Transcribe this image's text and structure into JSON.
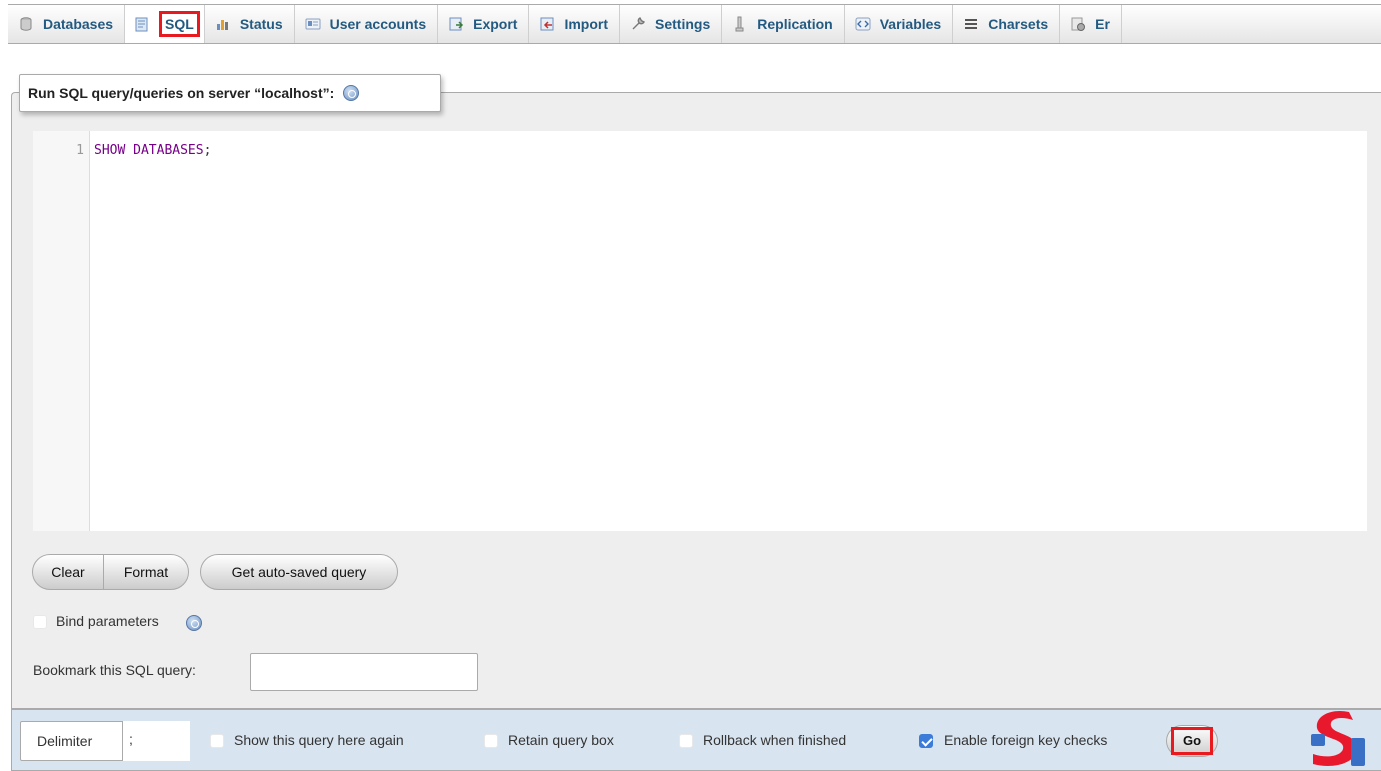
{
  "tabs": [
    {
      "label": "Databases",
      "icon": "database-icon"
    },
    {
      "label": "SQL",
      "icon": "sql-icon",
      "active": true
    },
    {
      "label": "Status",
      "icon": "status-icon"
    },
    {
      "label": "User accounts",
      "icon": "user-accounts-icon"
    },
    {
      "label": "Export",
      "icon": "export-icon"
    },
    {
      "label": "Import",
      "icon": "import-icon"
    },
    {
      "label": "Settings",
      "icon": "wrench-icon"
    },
    {
      "label": "Replication",
      "icon": "replication-icon"
    },
    {
      "label": "Variables",
      "icon": "variables-icon"
    },
    {
      "label": "Charsets",
      "icon": "charsets-icon"
    },
    {
      "label": "Er",
      "icon": "engines-icon"
    }
  ],
  "query_panel": {
    "legend": "Run SQL query/queries on server “localhost”:",
    "editor": {
      "line_number": "1",
      "keyword": "SHOW DATABASES",
      "terminator": ";"
    },
    "buttons": {
      "clear": "Clear",
      "format": "Format",
      "auto_saved": "Get auto-saved query"
    },
    "bind_parameters": {
      "label": "Bind parameters",
      "checked": false
    },
    "bookmark": {
      "label": "Bookmark this SQL query:",
      "value": ""
    }
  },
  "toolbar": {
    "delimiter_label": "Delimiter",
    "delimiter_value": ";",
    "show_query_again": {
      "label": "Show this query here again",
      "checked": false
    },
    "retain_query_box": {
      "label": "Retain query box",
      "checked": false
    },
    "rollback_when_finished": {
      "label": "Rollback when finished",
      "checked": false
    },
    "enable_foreign_key_checks": {
      "label": "Enable foreign key checks",
      "checked": true
    },
    "go": "Go"
  },
  "colors": {
    "link": "#235a81",
    "highlight": "#e8191f",
    "panel": "#eeeeee",
    "toolbar": "#d8e4f0",
    "keyword": "#770088",
    "checkbox_checked": "#3d7bd8"
  }
}
